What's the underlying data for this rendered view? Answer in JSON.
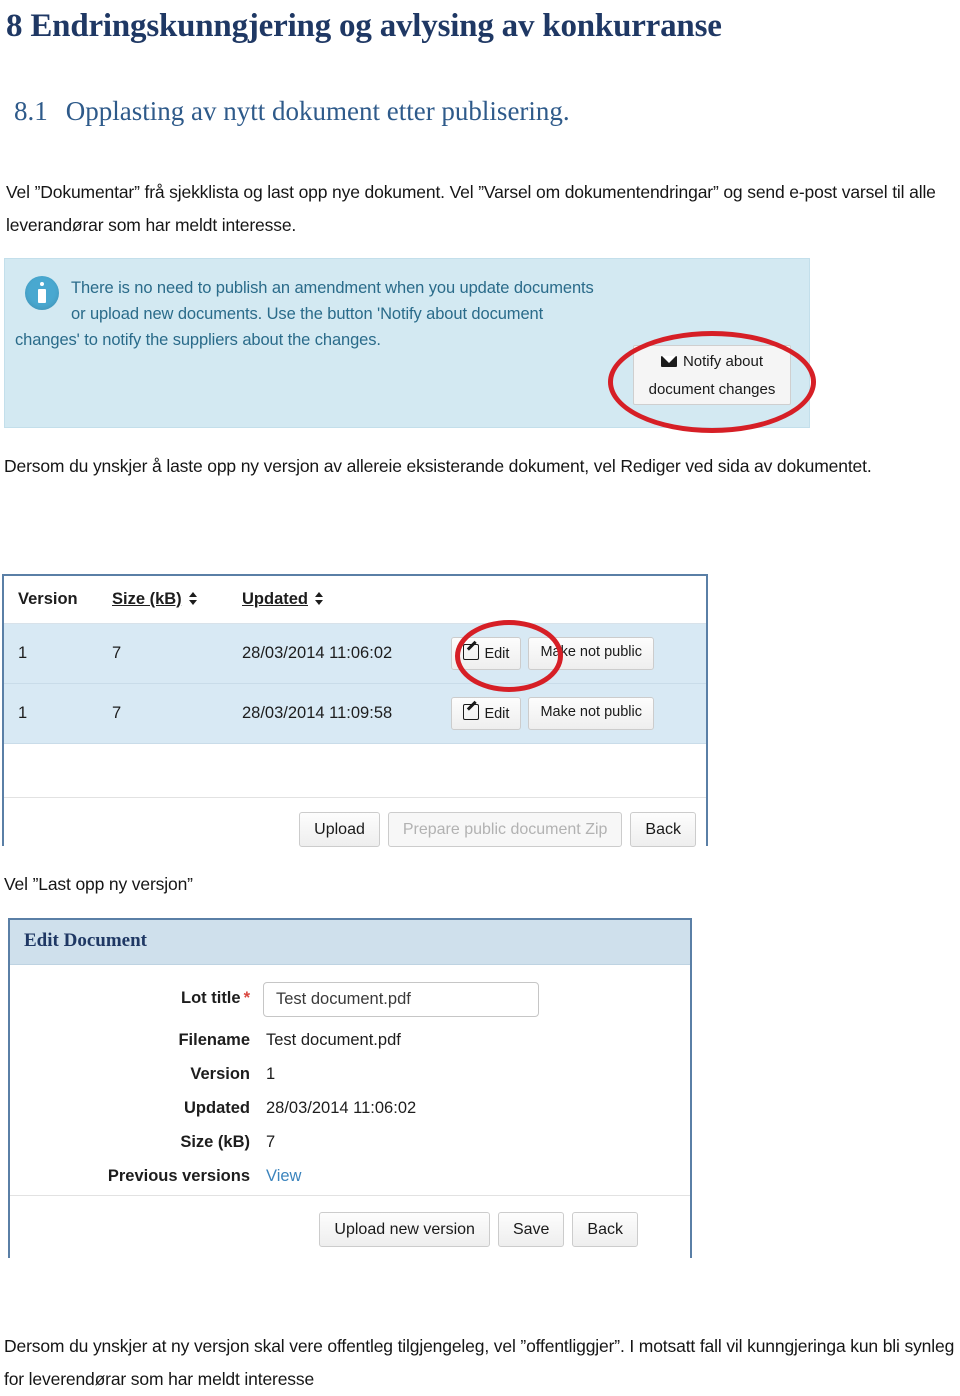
{
  "document": {
    "heading": "8 Endringskunngjering og avlysing av konkurranse",
    "subheading_number": "8.1",
    "subheading_text": "Opplasting av nytt dokument etter publisering.",
    "paragraph_intro": "Vel ”Dokumentar” frå sjekklista og last opp nye dokument. Vel ”Varsel om dokumentendringar” og send e-post varsel til alle leverandørar som har meldt interesse.",
    "paragraph_edit": "Dersom du ynskjer å laste opp ny versjon av allereie  eksisterande dokument, vel  Rediger ved sida av dokumentet.",
    "paragraph_upload": "Vel  ”Last opp ny versjon”",
    "paragraph_public": "Dersom du ynskjer at ny versjon skal vere offentleg tilgjengeleg, vel  ”offentliggjer”.  I motsatt fall vil kunngjeringa kun bli synleg for leverendørar som har meldt interesse"
  },
  "info_box": {
    "icon": "info-circle-icon",
    "line1": "There is no need to publish an amendment when you update documents",
    "line2": "or upload new documents. Use the button 'Notify about document",
    "line3": "changes' to notify the suppliers about the changes.",
    "notify_button": {
      "icon": "envelope-icon",
      "line1": "Notify about",
      "line2": "document changes"
    },
    "background_color": "#d3e9f2",
    "text_color": "#2a6b8a",
    "annotation_color": "#d61f26"
  },
  "versions_table": {
    "columns": [
      {
        "label": "Version",
        "sortable": false
      },
      {
        "label": "Size (kB)",
        "sortable": true
      },
      {
        "label": "Updated",
        "sortable": true
      }
    ],
    "rows": [
      {
        "version": "1",
        "size": "7",
        "updated": "28/03/2014 11:06:02",
        "edit_label": "Edit",
        "edit_icon": "pencil-icon",
        "make_not_public_label": "Make not public",
        "highlighted": true
      },
      {
        "version": "1",
        "size": "7",
        "updated": "28/03/2014 11:09:58",
        "edit_label": "Edit",
        "edit_icon": "pencil-icon",
        "make_not_public_label": "Make not public",
        "highlighted": false
      }
    ],
    "footer_buttons": [
      {
        "label": "Upload",
        "disabled": false
      },
      {
        "label": "Prepare public document Zip",
        "disabled": true
      },
      {
        "label": "Back",
        "disabled": false
      }
    ],
    "row_background": "#d8e9f4",
    "border_color": "#5a7fa6"
  },
  "edit_document": {
    "panel_title": "Edit Document",
    "fields": [
      {
        "label": "Lot title",
        "required": true,
        "value": "Test document.pdf",
        "type": "input"
      },
      {
        "label": "Filename",
        "required": false,
        "value": "Test document.pdf",
        "type": "text"
      },
      {
        "label": "Version",
        "required": false,
        "value": "1",
        "type": "text"
      },
      {
        "label": "Updated",
        "required": false,
        "value": "28/03/2014 11:06:02",
        "type": "text"
      },
      {
        "label": "Size (kB)",
        "required": false,
        "value": "7",
        "type": "text"
      },
      {
        "label": "Previous versions",
        "required": false,
        "value": "View",
        "type": "link"
      }
    ],
    "required_marker": "*",
    "footer_buttons": [
      {
        "label": "Upload new version"
      },
      {
        "label": "Save"
      },
      {
        "label": "Back"
      }
    ],
    "header_background": "#cfe0ec",
    "title_color": "#1f3864"
  }
}
